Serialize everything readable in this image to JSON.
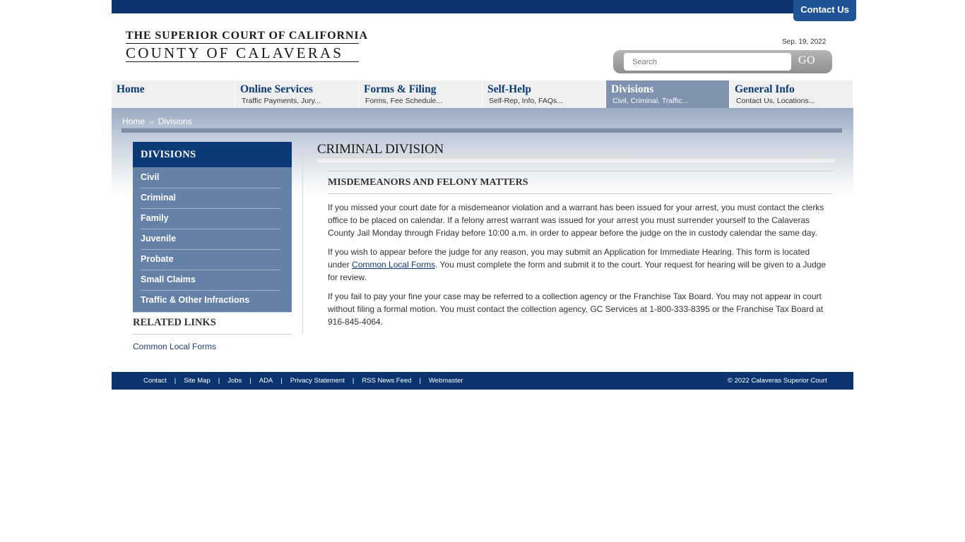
{
  "header": {
    "contact_button": "Contact Us",
    "logo_line1": "THE SUPERIOR COURT OF CALIFORNIA",
    "logo_line2": "COUNTY OF CALAVERAS",
    "date": "Sep. 19, 2022",
    "search_placeholder": "Search",
    "go_button": "GO"
  },
  "nav": {
    "items": [
      {
        "title": "Home",
        "sub": ""
      },
      {
        "title": "Online Services",
        "sub": "Traffic Payments, Jury..."
      },
      {
        "title": "Forms & Filing",
        "sub": "Forms, Fee Schedule..."
      },
      {
        "title": "Self-Help",
        "sub": "Self-Rep, Info, FAQs..."
      },
      {
        "title": "Divisions",
        "sub": "Civil, Criminal, Traffic..."
      },
      {
        "title": "General Info",
        "sub": "Contact Us, Locations..."
      }
    ],
    "active_index": 4
  },
  "breadcrumb": {
    "home": "Home",
    "separator": "››",
    "current": "Divisions"
  },
  "sidebar": {
    "heading": "DIVISIONS",
    "links": [
      "Civil",
      "Criminal",
      "Family",
      "Juvenile",
      "Probate",
      "Small Claims",
      "Traffic & Other Infractions"
    ],
    "related_heading": "RELATED LINKS",
    "related_link": "Common Local Forms"
  },
  "main": {
    "title": "CRIMINAL DIVISION",
    "subtitle": "MISDEMEANORS AND FELONY MATTERS",
    "para1": "If you missed your court date for a misdemeanor violation and a warrant has been issued for your arrest, you must contact the clerks office to be placed on calendar.  If a felony arrest warrant was issued for your arrest you must surrender yourself to the Calaveras County Jail Monday through Friday before 10:00 a.m. in order to appear before the judge on the in custody calendar the same day.",
    "para2_before": "If you wish to appear before the judge for any reason, you may submit an Application for Immediate Hearing. This form is located under ",
    "para2_link": "Common Local Forms",
    "para2_after": ". You must complete the form and submit it to the court.  Your request for hearing will be given to a Judge for review.",
    "para3": "If you fail to pay your fine your case may be referred to a collection agency or the Franchise Tax Board. You may not appear in court without filing a formal motion. You must contact the collection agency, GC Services at 1-800-333-8395 or the Franchise Tax Board at 916-845-4064."
  },
  "footer": {
    "links": [
      "Contact",
      "Site Map",
      "Jobs",
      "ADA",
      "Privacy Statement",
      "RSS News Feed",
      "Webmaster"
    ],
    "separator": "|",
    "copyright": "© 2022 Calaveras Superior Court"
  },
  "colors": {
    "navy": "#0a3570",
    "sidebar_blue": "#6481a7",
    "nav_active": "#7f92b0",
    "nav_inactive": "#eeeff1"
  }
}
